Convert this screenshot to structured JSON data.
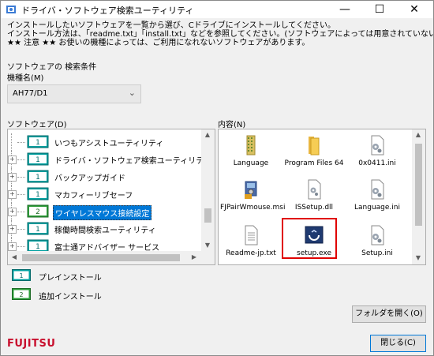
{
  "window": {
    "title": "ドライバ・ソフトウェア検索ユーティリティ",
    "minimize": "—",
    "maximize": "☐",
    "close": "✕"
  },
  "intro": {
    "line1": "インストールしたいソフトウェアを一覧から選び、Cドライブにインストールしてください。",
    "line2": "インストール方法は、「readme.txt」「install.txt」などを参照してください。(ソフトウェアによっては用意されていない場合もあります)",
    "line3": "★★ 注意 ★★ お使いの機種によっては、ご利用になれないソフトウェアがあります。"
  },
  "search_conditions": {
    "heading": "ソフトウェアの 検索条件",
    "model_label": "機種名(M)",
    "model_value": "AH77/D1"
  },
  "software_label": "ソフトウェア(D)",
  "contents_label": "内容(N)",
  "software_tree": [
    {
      "badge": "1",
      "label": "いつもアシストユーティリティ",
      "selected": false
    },
    {
      "badge": "1",
      "label": "ドライバ・ソフトウェア検索ユーティリティ",
      "selected": false
    },
    {
      "badge": "1",
      "label": "バックアップガイド",
      "selected": false
    },
    {
      "badge": "1",
      "label": "マカフィーリブセーフ",
      "selected": false
    },
    {
      "badge": "2",
      "label": "ワイヤレスマウス接続設定",
      "selected": true
    },
    {
      "badge": "1",
      "label": "稼働時間検索ユーティリティ",
      "selected": false
    },
    {
      "badge": "1",
      "label": "富士通アドバイザー サービス",
      "selected": false
    }
  ],
  "files": [
    {
      "name": "Language",
      "icon": "folder-icon-dotted"
    },
    {
      "name": "Program Files 64",
      "icon": "folder-icon"
    },
    {
      "name": "0x0411.ini",
      "icon": "ini-file-icon"
    },
    {
      "name": "FJPairWmouse.msi",
      "icon": "msi-installer-icon"
    },
    {
      "name": "ISSetup.dll",
      "icon": "dll-file-icon"
    },
    {
      "name": "Language.ini",
      "icon": "ini-file-icon"
    },
    {
      "name": "Readme-jp.txt",
      "icon": "text-file-icon"
    },
    {
      "name": "setup.exe",
      "icon": "setup-exe-icon"
    },
    {
      "name": "Setup.ini",
      "icon": "ini-file-icon"
    }
  ],
  "legend": {
    "preinstall_badge": "1",
    "preinstall": "プレインストール",
    "additional_badge": "2",
    "additional": "追加インストール"
  },
  "buttons": {
    "open_folder": "フォルダを開く(O)",
    "close": "閉じる(C)"
  },
  "brand": {
    "logo": "FUJITSU",
    "logo_color": "#c8102e"
  },
  "colors": {
    "selection": "#0078d7",
    "highlight_box": "#e00000",
    "badge_teal": "#00a0a0",
    "badge_green": "#2e9e3a"
  }
}
